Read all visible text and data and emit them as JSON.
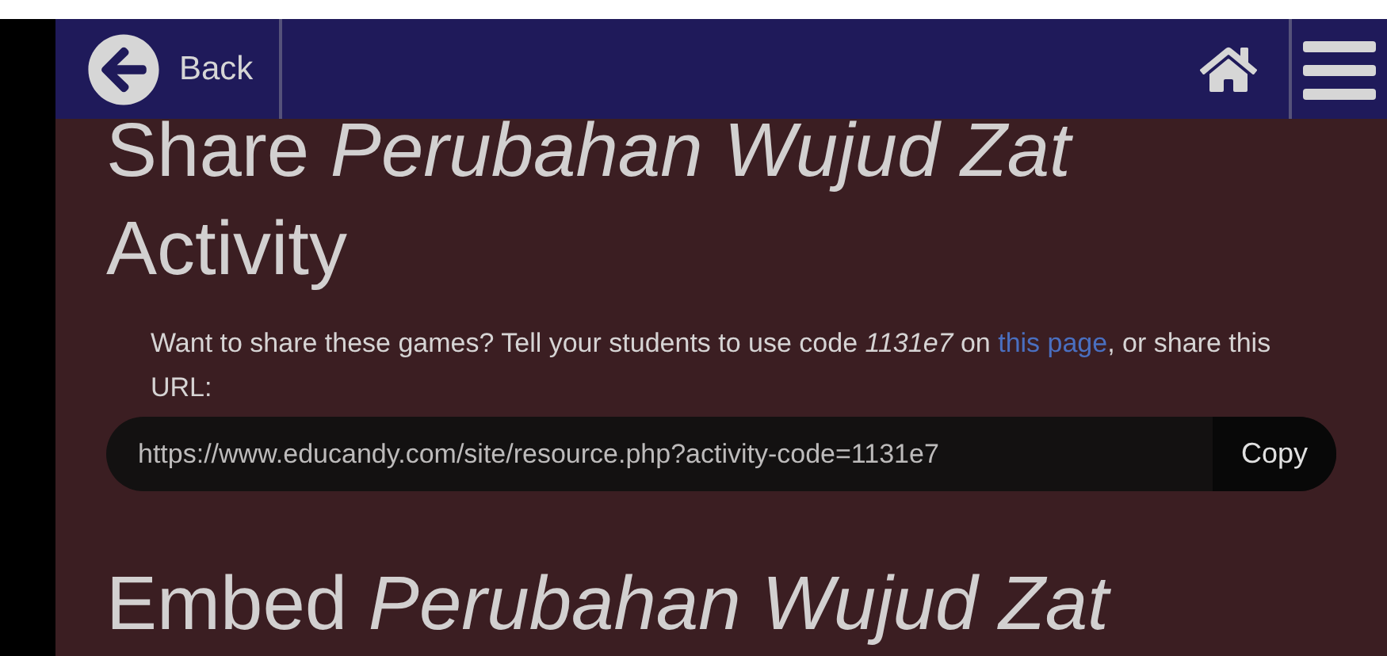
{
  "nav": {
    "back_label": "Back"
  },
  "share": {
    "title": "Share *Perubahan Wujud Zat* Activity",
    "instructions": {
      "before": "Want to share these games? Tell your students to use code ",
      "code": "1131e7",
      "between": " on ",
      "link": "this page",
      "after": ", or share this URL:"
    },
    "url": "https://www.educandy.com/site/resource.php?activity-code=1131e7",
    "copy_label": "Copy"
  },
  "embed": {
    "title": "Embed *Perubahan Wujud Zat*"
  }
}
